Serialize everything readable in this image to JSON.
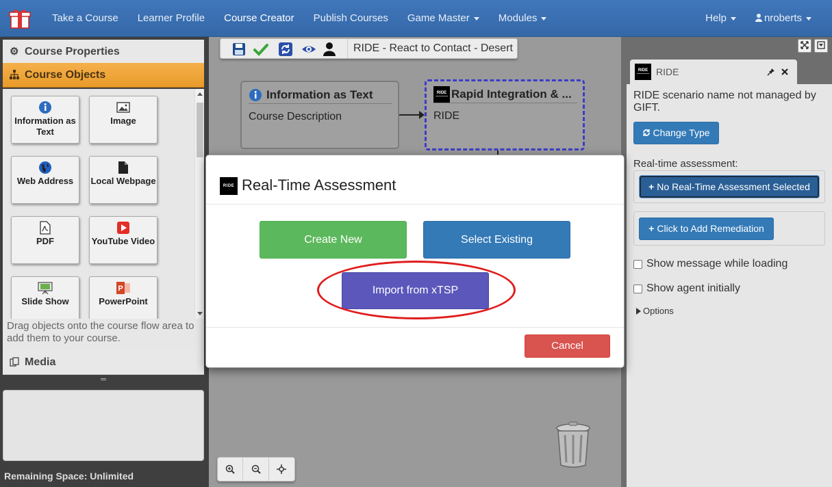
{
  "nav": {
    "items": [
      {
        "label": "Take a Course"
      },
      {
        "label": "Learner Profile"
      },
      {
        "label": "Course Creator"
      },
      {
        "label": "Publish Courses"
      },
      {
        "label": "Game Master"
      },
      {
        "label": "Modules"
      }
    ],
    "help": "Help",
    "user": "nroberts"
  },
  "left": {
    "course_properties": "Course Properties",
    "course_objects": "Course Objects",
    "objects": [
      {
        "label": "Information as Text",
        "icon": "info-icon"
      },
      {
        "label": "Image",
        "icon": "image-icon"
      },
      {
        "label": "Web Address",
        "icon": "globe-icon"
      },
      {
        "label": "Local Webpage",
        "icon": "file-icon"
      },
      {
        "label": "PDF",
        "icon": "pdf-icon"
      },
      {
        "label": "YouTube Video",
        "icon": "youtube-icon"
      },
      {
        "label": "Slide Show",
        "icon": "slideshow-icon"
      },
      {
        "label": "PowerPoint",
        "icon": "powerpoint-icon"
      }
    ],
    "drag_hint": "Drag objects onto the course flow area to add them to your course.",
    "media": "Media",
    "remaining_space": "Remaining Space: Unlimited"
  },
  "canvas": {
    "course_title": "RIDE - React to Contact - Desert",
    "node_info": {
      "title": "Information as Text",
      "body": "Course Description"
    },
    "node_ride": {
      "title": "Rapid Integration & ...",
      "body": "RIDE"
    }
  },
  "right": {
    "tab_title": "RIDE",
    "scenario_note": "RIDE scenario name not managed by GIFT.",
    "change_type": "Change Type",
    "rta_label": "Real-time assessment:",
    "no_rta": "No Real-Time Assessment Selected",
    "add_remediation": "Click to Add Remediation",
    "show_message": "Show message while loading",
    "show_agent": "Show agent initially",
    "options": "Options"
  },
  "modal": {
    "logo_text": "RIDE",
    "title": "Real-Time Assessment",
    "create_new": "Create New",
    "select_existing": "Select Existing",
    "import_xtsp": "Import from xTSP",
    "cancel": "Cancel"
  },
  "colors": {
    "nav": "#3a6fb0",
    "objects_header": "#f0a33a",
    "create_green": "#5cb85c",
    "select_blue": "#337ab7",
    "import_purple": "#5b57bb",
    "cancel_red": "#d9534f",
    "highlight_red": "#e01c1c"
  }
}
